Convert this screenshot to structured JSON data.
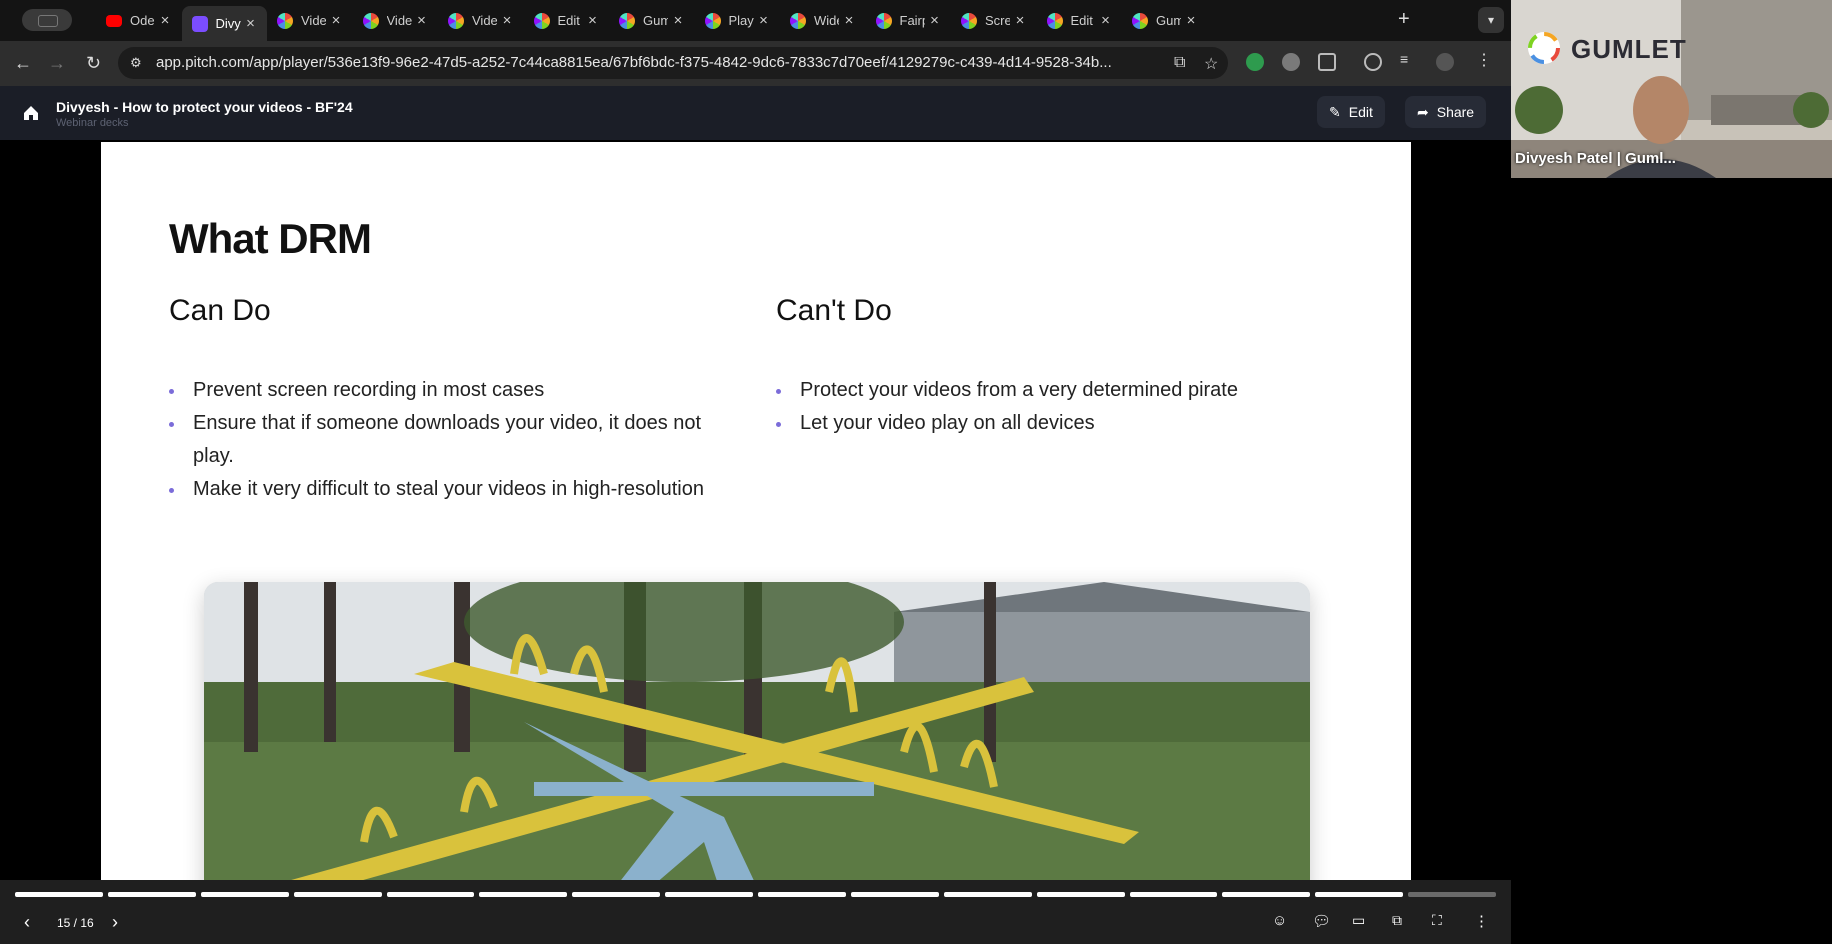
{
  "tabs": [
    {
      "label": "Ode t",
      "favicon": "youtube-icon"
    },
    {
      "label": "Divye",
      "favicon": "pitch-icon",
      "active": true
    },
    {
      "label": "Video",
      "favicon": "gumlet-icon"
    },
    {
      "label": "Video",
      "favicon": "gumlet-icon"
    },
    {
      "label": "Video",
      "favicon": "gumlet-icon"
    },
    {
      "label": "Edit l",
      "favicon": "gumlet-icon"
    },
    {
      "label": "Guml",
      "favicon": "gumlet-icon"
    },
    {
      "label": "Playe",
      "favicon": "gumlet-icon"
    },
    {
      "label": "Wide",
      "favicon": "gumlet-icon"
    },
    {
      "label": "Fairp",
      "favicon": "gumlet-icon"
    },
    {
      "label": "Scre",
      "favicon": "gumlet-icon"
    },
    {
      "label": "Edit",
      "favicon": "gumlet-icon"
    },
    {
      "label": "Guml",
      "favicon": "gumlet-icon"
    }
  ],
  "address": {
    "url": "app.pitch.com/app/player/536e13f9-96e2-47d5-a252-7c44ca8815ea/67bf6bdc-f375-4842-9dc6-7833c7d70eef/4129279c-c439-4d14-9528-34b..."
  },
  "pitch": {
    "title": "Divyesh - How to protect your videos - BF'24",
    "subtitle": "Webinar decks",
    "edit_label": "Edit",
    "share_label": "Share"
  },
  "slide": {
    "title": "What DRM",
    "can_heading": "Can Do",
    "cant_heading": "Can't Do",
    "can_items": [
      "Prevent screen recording in most cases",
      "Ensure that if someone downloads your video, it does not play.",
      "Make it very difficult to steal your videos in high-resolution"
    ],
    "cant_items": [
      "Protect your videos from a very determined pirate",
      "Let your video play on all devices"
    ]
  },
  "player": {
    "page": "15 / 16",
    "current": 15,
    "total": 16
  },
  "webcam": {
    "name": "Divyesh Patel | Guml...",
    "logo": "GUMLET"
  }
}
